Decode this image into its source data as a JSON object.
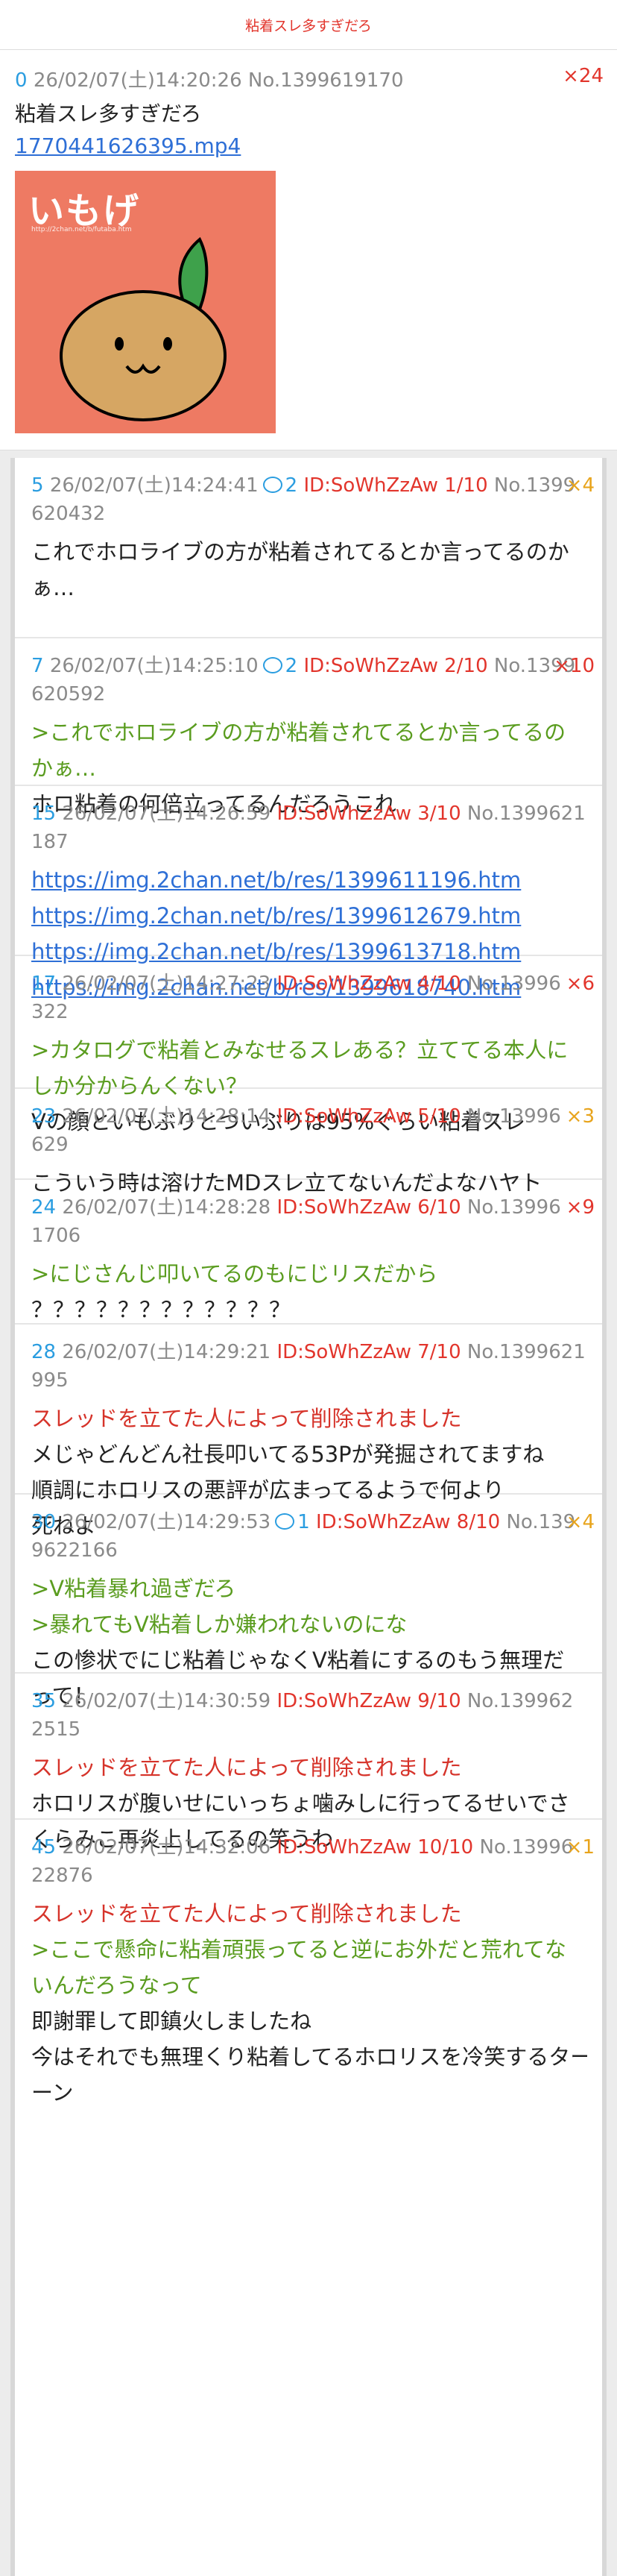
{
  "header": {
    "title": "粘着スレ多すぎだろ"
  },
  "op": {
    "num": "0",
    "datetime": "26/02/07(土)14:20:26",
    "no": "No.1399619170",
    "count": "×24",
    "text": "粘着スレ多すぎだろ",
    "file": "1770441626395.mp4",
    "thumb_logo": "いもげ",
    "thumb_url": "http://2chan.net/b/futaba.htm"
  },
  "posts": [
    {
      "num": "5",
      "dt": "26/02/07(土)14:24:41",
      "rep": "2",
      "id": "ID:SoWhZzAw 1/10",
      "no": "No.1399",
      "no2": "620432",
      "cnt": "×4",
      "lines": [
        {
          "t": "これでホロライブの方が粘着されてるとか言ってるのか"
        },
        {
          "t": "ぁ…"
        }
      ]
    },
    {
      "num": "7",
      "dt": "26/02/07(土)14:25:10",
      "rep": "2",
      "id": "ID:SoWhZzAw 2/10",
      "no": "No.1399",
      "no2": "620592",
      "cnt": "×10",
      "lines": [
        {
          "t": ">これでホロライブの方が粘着されてるとか言ってるの",
          "c": "q"
        },
        {
          "t": "かぁ…",
          "c": "q"
        },
        {
          "t": "ホロ粘着の何倍立ってるんだろうこれ"
        }
      ]
    },
    {
      "num": "15",
      "dt": "26/02/07(土)14:26:59",
      "id": "ID:SoWhZzAw 3/10",
      "no": "No.1399621",
      "no2": "187",
      "lines": [
        {
          "t": "https://img.2chan.net/b/res/1399611196.htm",
          "c": "lnk"
        },
        {
          "t": "https://img.2chan.net/b/res/1399612679.htm",
          "c": "lnk"
        },
        {
          "t": "https://img.2chan.net/b/res/1399613718.htm",
          "c": "lnk"
        },
        {
          "t": "https://img.2chan.net/b/res/1399618740.htm",
          "c": "lnk"
        }
      ]
    },
    {
      "num": "17",
      "dt": "26/02/07(土)14:27:23",
      "id": "ID:SoWhZzAw 4/10",
      "no": "No.13996",
      "no2": "322",
      "cnt": "×6",
      "lines": [
        {
          "t": ">カタログで粘着とみなせるスレある？立ててる本人に",
          "c": "q"
        },
        {
          "t": "しか分からんくない？",
          "c": "q"
        },
        {
          "t": "Vの顔といもぶりとついぶりは95%ぐらい粘着スレ"
        }
      ]
    },
    {
      "num": "23",
      "dt": "26/02/07(土)14:28:14",
      "id": "ID:SoWhZzAw 5/10",
      "no": "No.13996",
      "no2": "629",
      "cnt": "×3",
      "lines": [
        {
          "t": "こういう時は溶けたMDスレ立てないんだよなハヤト"
        }
      ]
    },
    {
      "num": "24",
      "dt": "26/02/07(土)14:28:28",
      "id": "ID:SoWhZzAw 6/10",
      "no": "No.13996",
      "no2": "1706",
      "cnt": "×9",
      "lines": [
        {
          "t": ">にじさんじ叩いてるのもにじリスだから",
          "c": "q"
        },
        {
          "t": "？？？？？？？？？？？？"
        }
      ]
    },
    {
      "num": "28",
      "dt": "26/02/07(土)14:29:21",
      "id": "ID:SoWhZzAw 7/10",
      "no": "No.1399621",
      "no2": "995",
      "lines": [
        {
          "t": "スレッドを立てた人によって削除されました",
          "c": "d"
        },
        {
          "t": "メじゃどんどん社長叩いてる53Pが発掘されてますね"
        },
        {
          "t": "順調にホロリスの悪評が広まってるようで何より"
        },
        {
          "t": "死ねよ"
        }
      ]
    },
    {
      "num": "30",
      "dt": "26/02/07(土)14:29:53",
      "rep": "1",
      "id": "ID:SoWhZzAw 8/10",
      "no": "No.139",
      "no2": "9622166",
      "cnt": "×4",
      "lines": [
        {
          "t": ">V粘着暴れ過ぎだろ",
          "c": "q"
        },
        {
          "t": ">暴れてもV粘着しか嫌われないのにな",
          "c": "q"
        },
        {
          "t": "この惨状でにじ粘着じゃなくV粘着にするのもう無理だ"
        },
        {
          "t": "って！"
        }
      ]
    },
    {
      "num": "35",
      "dt": "26/02/07(土)14:30:59",
      "id": "ID:SoWhZzAw 9/10",
      "no": "No.139962",
      "no2": "2515",
      "lines": [
        {
          "t": "スレッドを立てた人によって削除されました",
          "c": "d"
        },
        {
          "t": "ホロリスが腹いせにいっちょ噛みしに行ってるせいでさ"
        },
        {
          "t": "くらみこ再炎上してるの笑うわ"
        }
      ]
    },
    {
      "num": "45",
      "dt": "26/02/07(土)14:32:06",
      "id": "ID:SoWhZzAw 10/10",
      "no": "No.13996",
      "no2": "22876",
      "cnt": "×1",
      "lines": [
        {
          "t": "スレッドを立てた人によって削除されました",
          "c": "d"
        },
        {
          "t": ">ここで懸命に粘着頑張ってると逆にお外だと荒れてな",
          "c": "q"
        },
        {
          "t": "いんだろうなって",
          "c": "q"
        },
        {
          "t": "即謝罪して即鎮火しましたね"
        },
        {
          "t": "今はそれでも無理くり粘着してるホロリスを冷笑するター"
        },
        {
          "t": "ーン"
        }
      ]
    }
  ],
  "colors": {
    "accent_red": "#e2352c",
    "number_blue": "#2a9de0",
    "quote_green": "#5a9c1f",
    "link_blue": "#2e6fd6"
  }
}
